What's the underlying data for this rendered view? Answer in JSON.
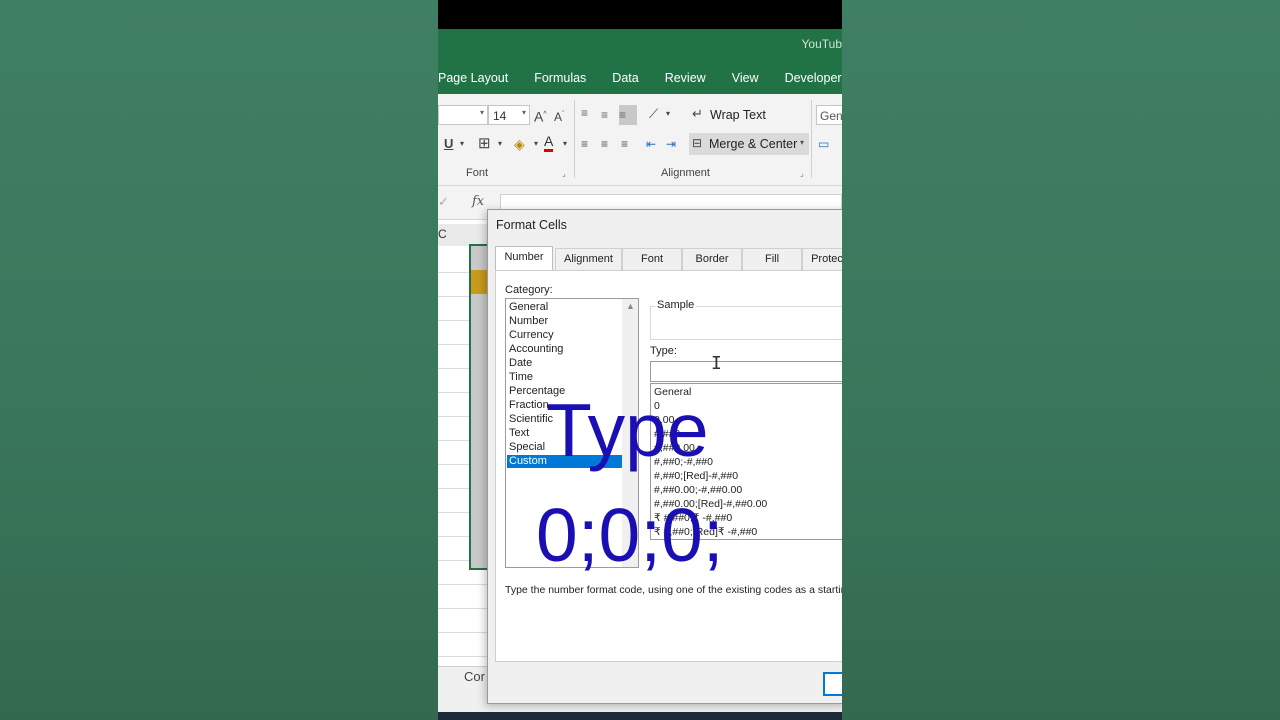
{
  "window": {
    "title_fragment": "YouTub"
  },
  "ribbon_tabs": [
    "Page Layout",
    "Formulas",
    "Data",
    "Review",
    "View",
    "Developer"
  ],
  "ribbon": {
    "font_size": "14",
    "wrap_text": "Wrap Text",
    "merge_center": "Merge & Center",
    "number_format": "Gene",
    "font_group": "Font",
    "alignment_group": "Alignment"
  },
  "formula_bar": {
    "fx": "fx"
  },
  "sheet": {
    "col_label": "C",
    "sheet_tab": "Cor"
  },
  "dialog": {
    "title": "Format Cells",
    "tabs": [
      "Number",
      "Alignment",
      "Font",
      "Border",
      "Fill",
      "Protec"
    ],
    "active_tab": "Number",
    "category_label": "Category:",
    "categories": [
      "General",
      "Number",
      "Currency",
      "Accounting",
      "Date",
      "Time",
      "Percentage",
      "Fraction",
      "Scientific",
      "Text",
      "Special",
      "Custom"
    ],
    "selected_category": "Custom",
    "sample_label": "Sample",
    "type_label": "Type:",
    "type_value": "",
    "formats": [
      "General",
      "0",
      "0.00",
      "#,##0",
      "#,##0.00",
      "#,##0;-#,##0",
      "#,##0;[Red]-#,##0",
      "#,##0.00;-#,##0.00",
      "#,##0.00;[Red]-#,##0.00",
      "₹ #,##0;₹ -#,##0",
      "₹ #,##0;[Red]₹ -#,##0"
    ],
    "help_text": "Type the number format code, using one of the existing codes as a startin"
  },
  "overlay": {
    "line1": "Type",
    "line2": "0;0;0;"
  },
  "colors": {
    "excel_green": "#217346",
    "overlay_blue": "#1a0fb3",
    "selection_blue": "#0078d7"
  }
}
